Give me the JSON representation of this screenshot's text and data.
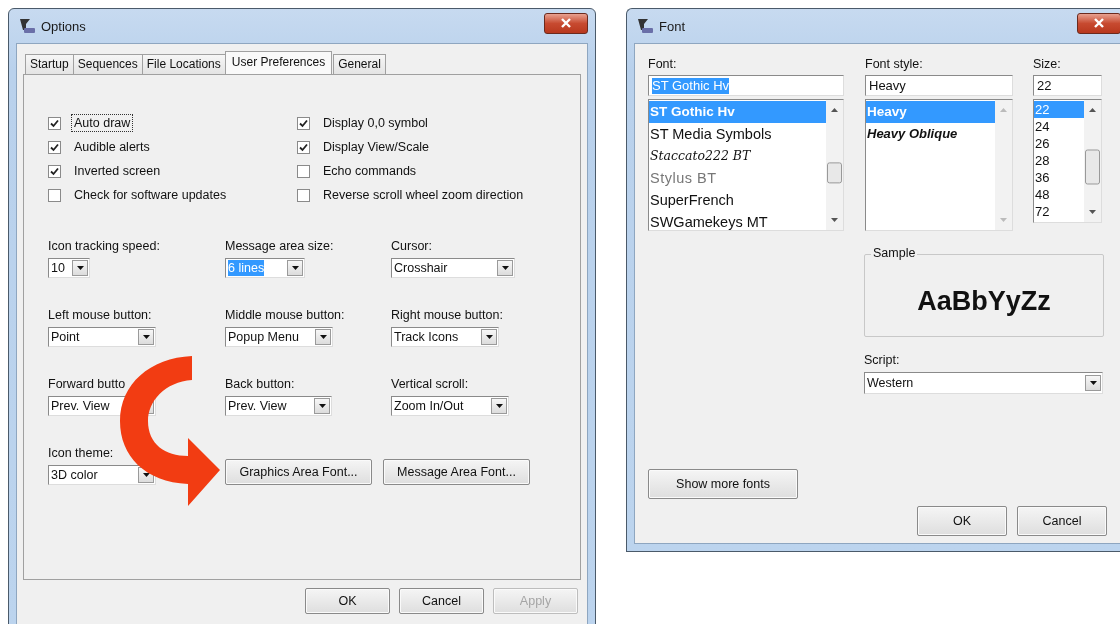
{
  "options_window": {
    "title": "Options",
    "tabs": [
      {
        "label": "Startup",
        "selected": false
      },
      {
        "label": "Sequences",
        "selected": false
      },
      {
        "label": "File Locations",
        "selected": false
      },
      {
        "label": "User Preferences",
        "selected": true
      },
      {
        "label": "General",
        "selected": false
      }
    ],
    "left_checkboxes": [
      {
        "label": "Auto draw",
        "checked": true,
        "focused": true
      },
      {
        "label": "Audible alerts",
        "checked": true,
        "focused": false
      },
      {
        "label": "Inverted screen",
        "checked": true,
        "focused": false
      },
      {
        "label": "Check for software updates",
        "checked": false,
        "focused": false
      }
    ],
    "right_checkboxes": [
      {
        "label": "Display 0,0 symbol",
        "checked": true,
        "focused": false
      },
      {
        "label": "Display View/Scale",
        "checked": true,
        "focused": false
      },
      {
        "label": "Echo commands",
        "checked": false,
        "focused": false
      },
      {
        "label": "Reverse scroll wheel zoom direction",
        "checked": false,
        "focused": false
      }
    ],
    "dropdowns": [
      {
        "label": "Icon tracking speed:",
        "value": "10",
        "highlighted": false
      },
      {
        "label": "Message area size:",
        "value": "6 lines",
        "highlighted": true
      },
      {
        "label": "Cursor:",
        "value": "Crosshair",
        "highlighted": false
      },
      {
        "label": "Left mouse button:",
        "value": "Point",
        "highlighted": false
      },
      {
        "label": "Middle mouse button:",
        "value": "Popup Menu",
        "highlighted": false
      },
      {
        "label": "Right mouse button:",
        "value": "Track Icons",
        "highlighted": false
      },
      {
        "label": "Forward butto",
        "value": "Prev. View",
        "highlighted": false
      },
      {
        "label": "Back button:",
        "value": "Prev. View",
        "highlighted": false
      },
      {
        "label": "Vertical scroll:",
        "value": "Zoom In/Out",
        "highlighted": false
      },
      {
        "label": "Icon theme:",
        "value": "3D color",
        "highlighted": false
      }
    ],
    "font_buttons": [
      "Graphics Area Font...",
      "Message Area Font..."
    ],
    "buttons": [
      {
        "label": "OK",
        "disabled": false
      },
      {
        "label": "Cancel",
        "disabled": false
      },
      {
        "label": "Apply",
        "disabled": true
      }
    ]
  },
  "font_window": {
    "title": "Font",
    "columns": [
      {
        "label": "Font:",
        "value": "ST Gothic Hv",
        "highlighted": true,
        "items": [
          {
            "text": "ST Gothic Hv",
            "kind": "bold",
            "selected": true
          },
          {
            "text": "ST Media Symbols",
            "kind": "regular",
            "selected": false
          },
          {
            "text": "Staccato222 BT",
            "kind": "script",
            "selected": false
          },
          {
            "text": "Stylus BT",
            "kind": "outline",
            "selected": false
          },
          {
            "text": "SuperFrench",
            "kind": "regular",
            "selected": false
          },
          {
            "text": "SWGamekeys MT",
            "kind": "regular",
            "selected": false
          }
        ]
      },
      {
        "label": "Font style:",
        "value": "Heavy",
        "highlighted": false,
        "items": [
          {
            "text": "Heavy",
            "kind": "bold",
            "selected": true
          },
          {
            "text": "Heavy Oblique",
            "kind": "bolditalic",
            "selected": false
          }
        ]
      },
      {
        "label": "Size:",
        "value": "22",
        "highlighted": false,
        "items": [
          {
            "text": "22",
            "kind": "small",
            "selected": true
          },
          {
            "text": "24",
            "kind": "small",
            "selected": false
          },
          {
            "text": "26",
            "kind": "small",
            "selected": false
          },
          {
            "text": "28",
            "kind": "small",
            "selected": false
          },
          {
            "text": "36",
            "kind": "small",
            "selected": false
          },
          {
            "text": "48",
            "kind": "small",
            "selected": false
          },
          {
            "text": "72",
            "kind": "small",
            "selected": false
          }
        ]
      }
    ],
    "sample": {
      "label": "Sample",
      "text": "AaBbYyZz"
    },
    "script": {
      "label": "Script:",
      "value": "Western"
    },
    "show_more": "Show more fonts",
    "buttons": [
      {
        "label": "OK",
        "disabled": false
      },
      {
        "label": "Cancel",
        "disabled": false
      }
    ]
  }
}
